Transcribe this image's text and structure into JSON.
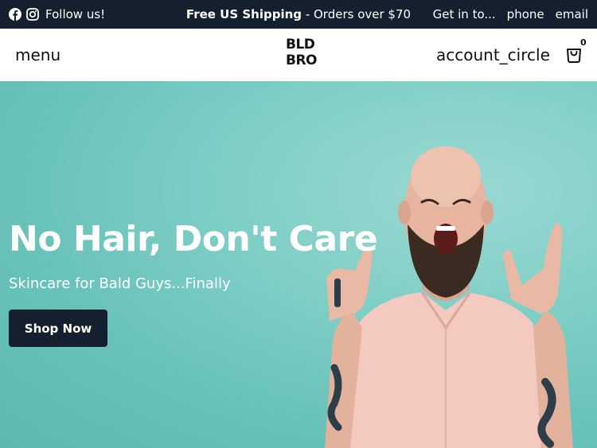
{
  "topbar": {
    "follow_label": "Follow us!",
    "announcement_bold": "Free US Shipping",
    "announcement_rest": " - Orders over $70",
    "contact_label": "Get in to...",
    "phone_label": "phone",
    "email_label": "email"
  },
  "header": {
    "menu_label": "menu",
    "logo_line1": "BLD",
    "logo_line2": "BRO",
    "account_label": "account_circle",
    "cart_count": "0"
  },
  "hero": {
    "title": "No Hair, Don't Care",
    "subtitle": "Skincare for Bald Guys...Finally",
    "cta_label": "Shop Now"
  },
  "colors": {
    "dark_navy": "#14202e",
    "hero_teal": "#6ac3bb",
    "shirt_pink": "#f3c9c0"
  },
  "icons": [
    "facebook-icon",
    "instagram-icon",
    "cart-icon"
  ]
}
